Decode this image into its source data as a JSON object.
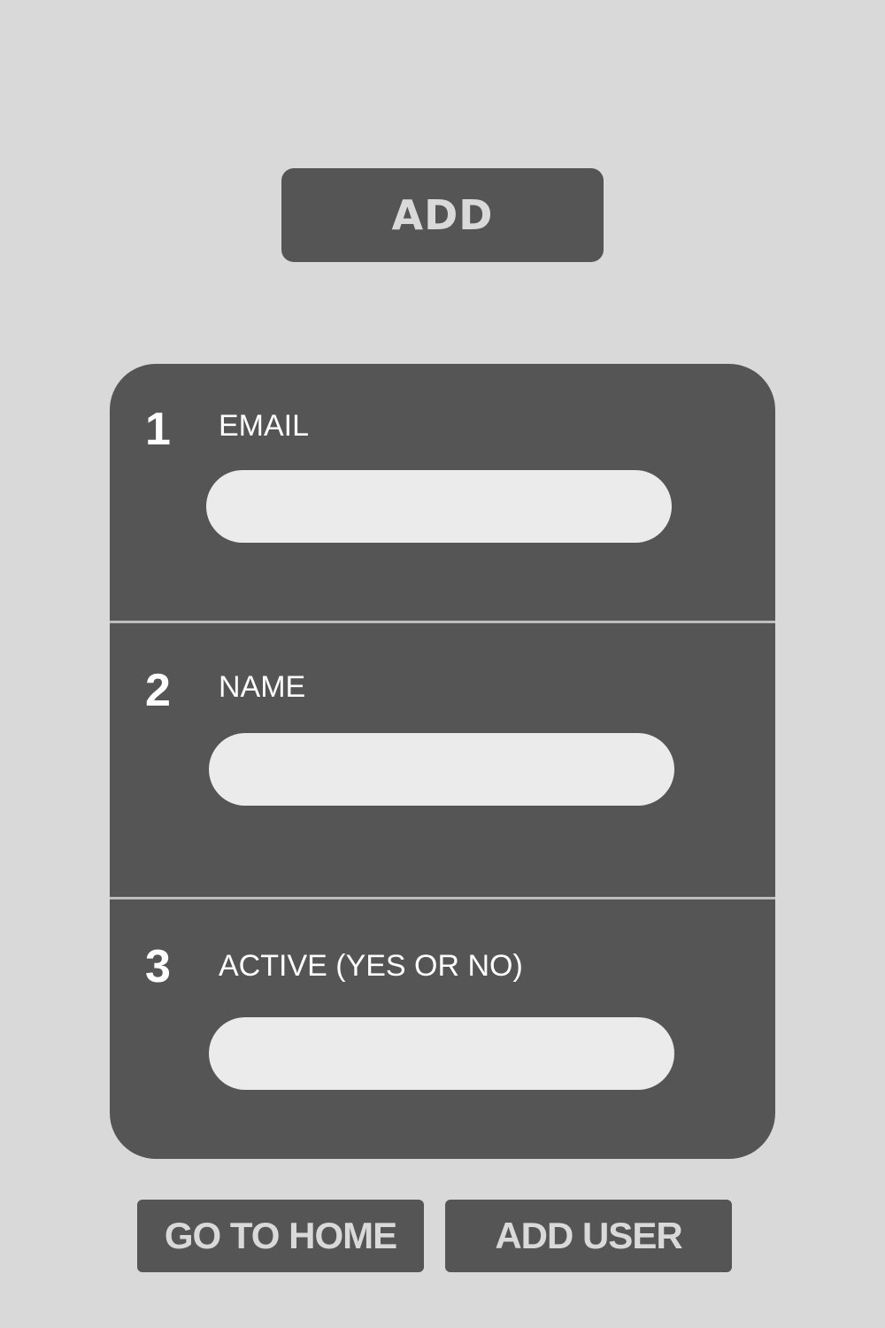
{
  "header": {
    "add_label": "ADD"
  },
  "form": {
    "fields": [
      {
        "number": "1",
        "label": "EMAIL",
        "value": "",
        "placeholder": ""
      },
      {
        "number": "2",
        "label": "NAME",
        "value": "",
        "placeholder": ""
      },
      {
        "number": "3",
        "label": "ACTIVE (YES OR NO)",
        "value": "",
        "placeholder": ""
      }
    ]
  },
  "actions": {
    "go_home_label": "GO TO HOME",
    "add_user_label": "ADD USER"
  },
  "colors": {
    "background": "#d9d9d9",
    "panel": "#555555",
    "input": "#ebebeb",
    "divider": "#bdbdbd",
    "button_text": "#d9d9d9",
    "label_text": "#ffffff"
  }
}
